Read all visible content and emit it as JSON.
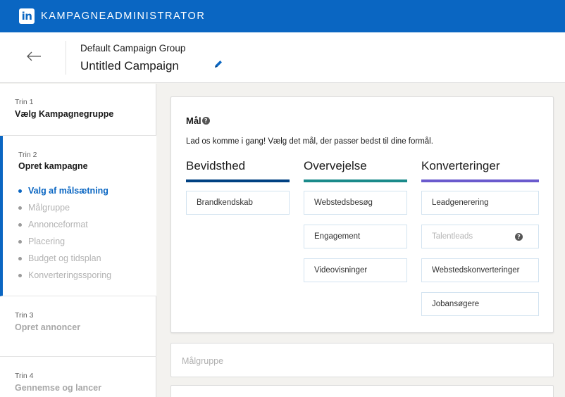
{
  "app": {
    "logo_text": "in",
    "title": "KAMPAGNEADMINISTRATOR",
    "brand_color": "#0a66c2"
  },
  "header": {
    "back_icon": "arrow-left-icon",
    "group_name": "Default Campaign Group",
    "campaign_name": "Untitled Campaign",
    "edit_icon": "pencil-icon"
  },
  "sidebar": {
    "steps": [
      {
        "number": "Trin 1",
        "title": "Vælg Kampagnegruppe"
      },
      {
        "number": "Trin 2",
        "title": "Opret kampagne",
        "substeps": [
          "Valg af målsætning",
          "Målgruppe",
          "Annonceformat",
          "Placering",
          "Budget og tidsplan",
          "Konverteringssporing"
        ],
        "active_substep": "Valg af målsætning"
      },
      {
        "number": "Trin 3",
        "title": "Opret annoncer"
      },
      {
        "number": "Trin 4",
        "title": "Gennemse og lancer"
      }
    ]
  },
  "objective": {
    "title": "Mål",
    "help_icon": "question-circle-icon",
    "help_glyph": "?",
    "description": "Lad os komme i gang! Vælg det mål, der passer bedst til dine formål.",
    "columns": [
      {
        "heading": "Bevidsthed",
        "color": "#004182",
        "options": [
          "Brandkendskab"
        ]
      },
      {
        "heading": "Overvejelse",
        "color": "#1a8a8a",
        "options": [
          "Webstedsbesøg",
          "Engagement",
          "Videovisninger"
        ]
      },
      {
        "heading": "Konverteringer",
        "color": "#6a5acd",
        "options": [
          "Leadgenerering",
          "Talentleads",
          "Webstedskonverteringer",
          "Jobansøgere"
        ],
        "disabled_option": "Talentleads"
      }
    ]
  },
  "collapsed_sections": [
    "Målgruppe"
  ]
}
